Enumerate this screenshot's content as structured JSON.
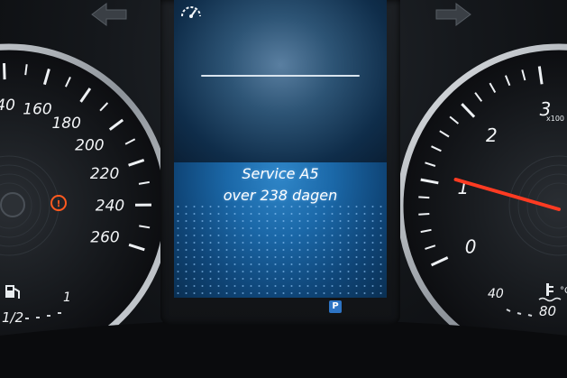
{
  "display": {
    "message_line1": "Service A5",
    "message_line2": "over 238 dagen",
    "parking_indicator": "P"
  },
  "speedometer": {
    "ticks": [
      "40",
      "160",
      "180",
      "200",
      "220",
      "240",
      "260"
    ],
    "fuel_label": "1/2",
    "fuel_full": "1"
  },
  "tachometer": {
    "ticks": [
      "0",
      "1",
      "2",
      "3"
    ],
    "unit": "x100",
    "temp_low": "40",
    "temp_high": "80",
    "needle_value": 1.1
  },
  "icons": {
    "speed_limit": "speedometer-icon",
    "left_turn": "left-turn-arrow-icon",
    "right_turn": "right-turn-arrow-icon",
    "fuel": "fuel-pump-icon",
    "coolant": "coolant-temperature-icon",
    "warning": "brake-warning-icon"
  },
  "colors": {
    "needle": "#ff3b22",
    "warning": "#ff5a1f",
    "display_blue": "#1b68a8"
  }
}
